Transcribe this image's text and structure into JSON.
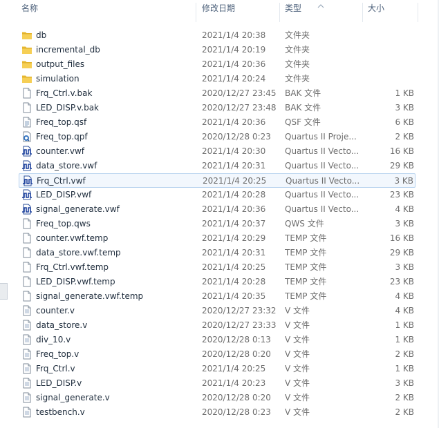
{
  "columns": {
    "name": "名称",
    "date": "修改日期",
    "type": "类型",
    "size": "大小"
  },
  "files": [
    {
      "name": "db",
      "date": "2021/1/4 20:38",
      "type": "文件夹",
      "size": "",
      "icon": "folder-icon"
    },
    {
      "name": "incremental_db",
      "date": "2021/1/4 20:19",
      "type": "文件夹",
      "size": "",
      "icon": "folder-icon"
    },
    {
      "name": "output_files",
      "date": "2021/1/4 20:36",
      "type": "文件夹",
      "size": "",
      "icon": "folder-icon"
    },
    {
      "name": "simulation",
      "date": "2021/1/4 20:24",
      "type": "文件夹",
      "size": "",
      "icon": "folder-icon"
    },
    {
      "name": "Frq_Ctrl.v.bak",
      "date": "2020/12/27 23:45",
      "type": "BAK 文件",
      "size": "1 KB",
      "icon": "blank-file-icon"
    },
    {
      "name": "LED_DISP.v.bak",
      "date": "2020/12/27 23:48",
      "type": "BAK 文件",
      "size": "3 KB",
      "icon": "blank-file-icon"
    },
    {
      "name": "Freq_top.qsf",
      "date": "2021/1/4 20:36",
      "type": "QSF 文件",
      "size": "6 KB",
      "icon": "text-file-icon"
    },
    {
      "name": "Freq_top.qpf",
      "date": "2020/12/28 0:23",
      "type": "Quartus II Proje...",
      "size": "2 KB",
      "icon": "quartus-project-icon"
    },
    {
      "name": "counter.vwf",
      "date": "2021/1/4 20:30",
      "type": "Quartus II Vecto...",
      "size": "16 KB",
      "icon": "waveform-file-icon"
    },
    {
      "name": "data_store.vwf",
      "date": "2021/1/4 20:31",
      "type": "Quartus II Vecto...",
      "size": "29 KB",
      "icon": "waveform-file-icon"
    },
    {
      "name": "Frq_Ctrl.vwf",
      "date": "2021/1/4 20:25",
      "type": "Quartus II Vecto...",
      "size": "3 KB",
      "icon": "waveform-file-icon",
      "selected": true
    },
    {
      "name": "LED_DISP.vwf",
      "date": "2021/1/4 20:28",
      "type": "Quartus II Vecto...",
      "size": "23 KB",
      "icon": "waveform-file-icon"
    },
    {
      "name": "signal_generate.vwf",
      "date": "2021/1/4 20:36",
      "type": "Quartus II Vecto...",
      "size": "4 KB",
      "icon": "waveform-file-icon"
    },
    {
      "name": "Freq_top.qws",
      "date": "2021/1/4 20:37",
      "type": "QWS 文件",
      "size": "3 KB",
      "icon": "blank-file-icon"
    },
    {
      "name": "counter.vwf.temp",
      "date": "2021/1/4 20:29",
      "type": "TEMP 文件",
      "size": "16 KB",
      "icon": "blank-file-icon"
    },
    {
      "name": "data_store.vwf.temp",
      "date": "2021/1/4 20:31",
      "type": "TEMP 文件",
      "size": "29 KB",
      "icon": "blank-file-icon"
    },
    {
      "name": "Frq_Ctrl.vwf.temp",
      "date": "2021/1/4 20:25",
      "type": "TEMP 文件",
      "size": "3 KB",
      "icon": "blank-file-icon"
    },
    {
      "name": "LED_DISP.vwf.temp",
      "date": "2021/1/4 20:28",
      "type": "TEMP 文件",
      "size": "23 KB",
      "icon": "blank-file-icon"
    },
    {
      "name": "signal_generate.vwf.temp",
      "date": "2021/1/4 20:35",
      "type": "TEMP 文件",
      "size": "4 KB",
      "icon": "blank-file-icon"
    },
    {
      "name": "counter.v",
      "date": "2020/12/27 23:32",
      "type": "V 文件",
      "size": "4 KB",
      "icon": "verilog-file-icon"
    },
    {
      "name": "data_store.v",
      "date": "2020/12/27 23:33",
      "type": "V 文件",
      "size": "1 KB",
      "icon": "verilog-file-icon"
    },
    {
      "name": "div_10.v",
      "date": "2020/12/28 0:13",
      "type": "V 文件",
      "size": "1 KB",
      "icon": "verilog-file-icon"
    },
    {
      "name": "Freq_top.v",
      "date": "2020/12/28 0:20",
      "type": "V 文件",
      "size": "2 KB",
      "icon": "verilog-file-icon"
    },
    {
      "name": "Frq_Ctrl.v",
      "date": "2021/1/4 20:25",
      "type": "V 文件",
      "size": "1 KB",
      "icon": "verilog-file-icon"
    },
    {
      "name": "LED_DISP.v",
      "date": "2021/1/4 20:23",
      "type": "V 文件",
      "size": "3 KB",
      "icon": "verilog-file-icon"
    },
    {
      "name": "signal_generate.v",
      "date": "2020/12/28 0:20",
      "type": "V 文件",
      "size": "2 KB",
      "icon": "verilog-file-icon"
    },
    {
      "name": "testbench.v",
      "date": "2020/12/28 0:23",
      "type": "V 文件",
      "size": "2 KB",
      "icon": "verilog-file-icon"
    }
  ]
}
